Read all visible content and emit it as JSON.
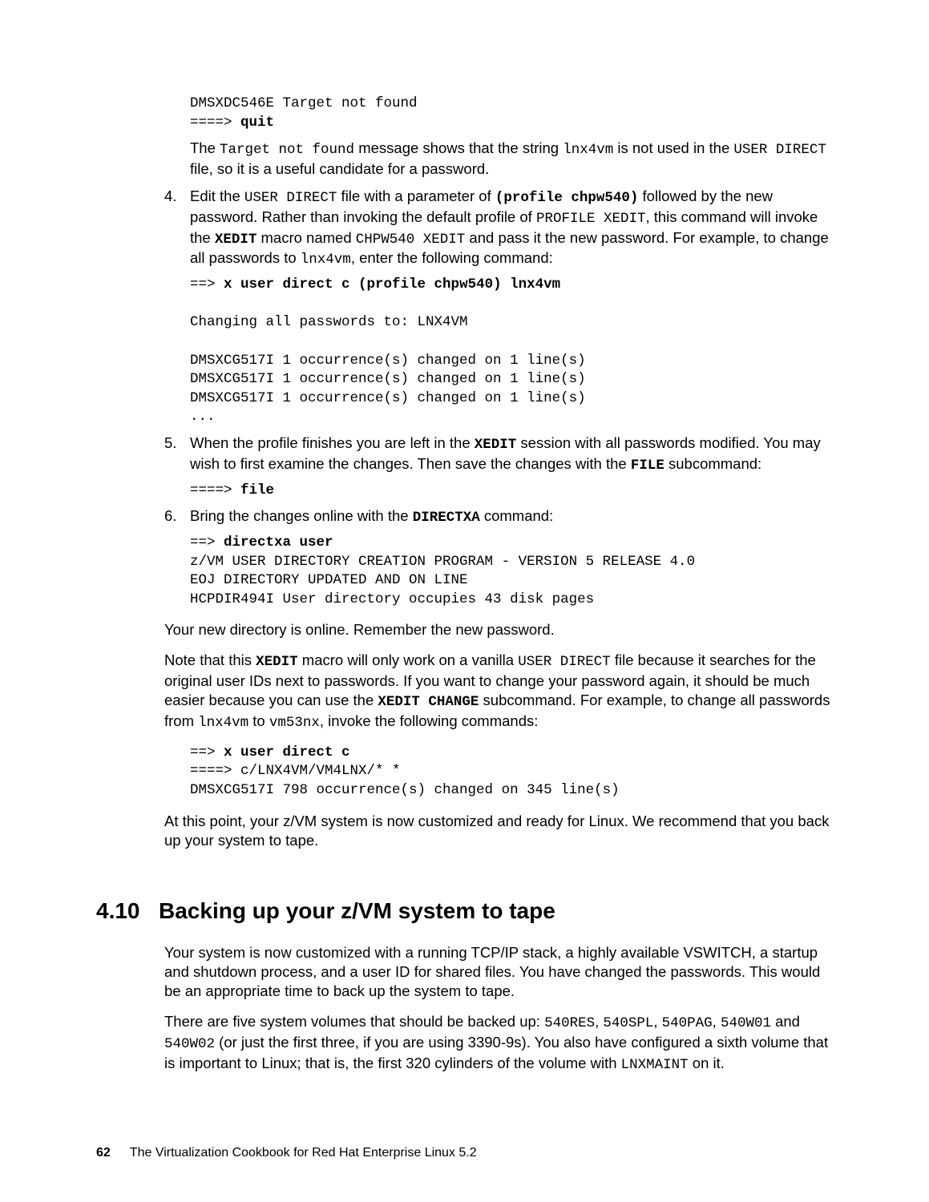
{
  "top_code": {
    "l1": "DMSXDC546E Target not found",
    "l2_prompt": "====> ",
    "l2_cmd": "quit"
  },
  "after_top": {
    "t1": "The ",
    "mono1": "Target not found",
    "t2": " message shows that the string ",
    "mono2": "lnx4vm",
    "t3": " is not used in the ",
    "mono3": "USER DIRECT",
    "t4": " file, so it is a useful candidate for a password."
  },
  "step4": {
    "num": "4.",
    "t1": "Edit the ",
    "mono1": "USER DIRECT",
    "t2": " file with a parameter of ",
    "mono_bold1": "(profile chpw540)",
    "t3": " followed by the new password. Rather than invoking the default profile of ",
    "mono2": "PROFILE XEDIT",
    "t4": ", this command will invoke the ",
    "bold1": "XEDIT",
    "t5": " macro named ",
    "mono3": "CHPW540 XEDIT",
    "t6": " and pass it the new password. For example, to change all passwords to ",
    "mono4": "lnx4vm",
    "t7": ", enter the following command:",
    "code_prompt": "==> ",
    "code_cmd": "x user direct c (profile chpw540) lnx4vm",
    "code_out": "Changing all passwords to: LNX4VM\n\nDMSXCG517I 1 occurrence(s) changed on 1 line(s)\nDMSXCG517I 1 occurrence(s) changed on 1 line(s)\nDMSXCG517I 1 occurrence(s) changed on 1 line(s)\n..."
  },
  "step5": {
    "num": "5.",
    "t1": "When the profile finishes you are left in the ",
    "bold1": "XEDIT",
    "t2": " session with all passwords modified. You may wish to first examine the changes. Then save the changes with the ",
    "bold2": "FILE",
    "t3": " subcommand:",
    "code_prompt": "====> ",
    "code_cmd": "file"
  },
  "step6": {
    "num": "6.",
    "t1": "Bring the changes online with the ",
    "bold1": "DIRECTXA",
    "t2": " command:",
    "code_prompt": "==> ",
    "code_cmd": "directxa user",
    "code_out": "z/VM USER DIRECTORY CREATION PROGRAM - VERSION 5 RELEASE 4.0\nEOJ DIRECTORY UPDATED AND ON LINE\nHCPDIR494I User directory occupies 43 disk pages"
  },
  "para1": "Your new directory is online. Remember the new password.",
  "para2": {
    "t1": "Note that this ",
    "bold1": "XEDIT",
    "t2": " macro will only work on a vanilla ",
    "mono1": "USER DIRECT",
    "t3": " file because it searches for the original user IDs next to passwords. If you want to change your password again, it should be much easier because you can use the ",
    "bold2": "XEDIT CHANGE",
    "t4": " subcommand. For example, to change all passwords from ",
    "mono2": "lnx4vm",
    "t5": " to ",
    "mono3": "vm53nx",
    "t6": ", invoke the following commands:"
  },
  "code3": {
    "prompt1": "==> ",
    "cmd1": "x user direct c",
    "line2": "====> c/LNX4VM/VM4LNX/* *",
    "line3": "DMSXCG517I 798 occurrence(s) changed on 345 line(s)"
  },
  "para3": "At this point, your z/VM system is now customized and ready for Linux. We recommend that you back up your system to tape.",
  "section": {
    "num": "4.10",
    "title": "Backing up your z/VM system to tape"
  },
  "sec_p1": "Your system is now customized with a running TCP/IP stack, a highly available VSWITCH, a startup and shutdown process, and a user ID for shared files. You have changed the passwords. This would be an appropriate time to back up the system to tape.",
  "sec_p2": {
    "t1": "There are five system volumes that should be backed up: ",
    "mono1": "540RES",
    "c": ", ",
    "mono2": "540SPL",
    "mono3": "540PAG",
    "mono4": "540W01",
    "and": " and ",
    "mono5": "540W02",
    "t2": " (or just the first three, if you are using 3390-9s). You also have configured a sixth volume that is important to Linux; that is, the first 320 cylinders of the volume with ",
    "mono6": "LNXMAINT",
    "t3": " on it."
  },
  "footer": {
    "page": "62",
    "title": "The Virtualization Cookbook for Red Hat Enterprise Linux 5.2"
  }
}
